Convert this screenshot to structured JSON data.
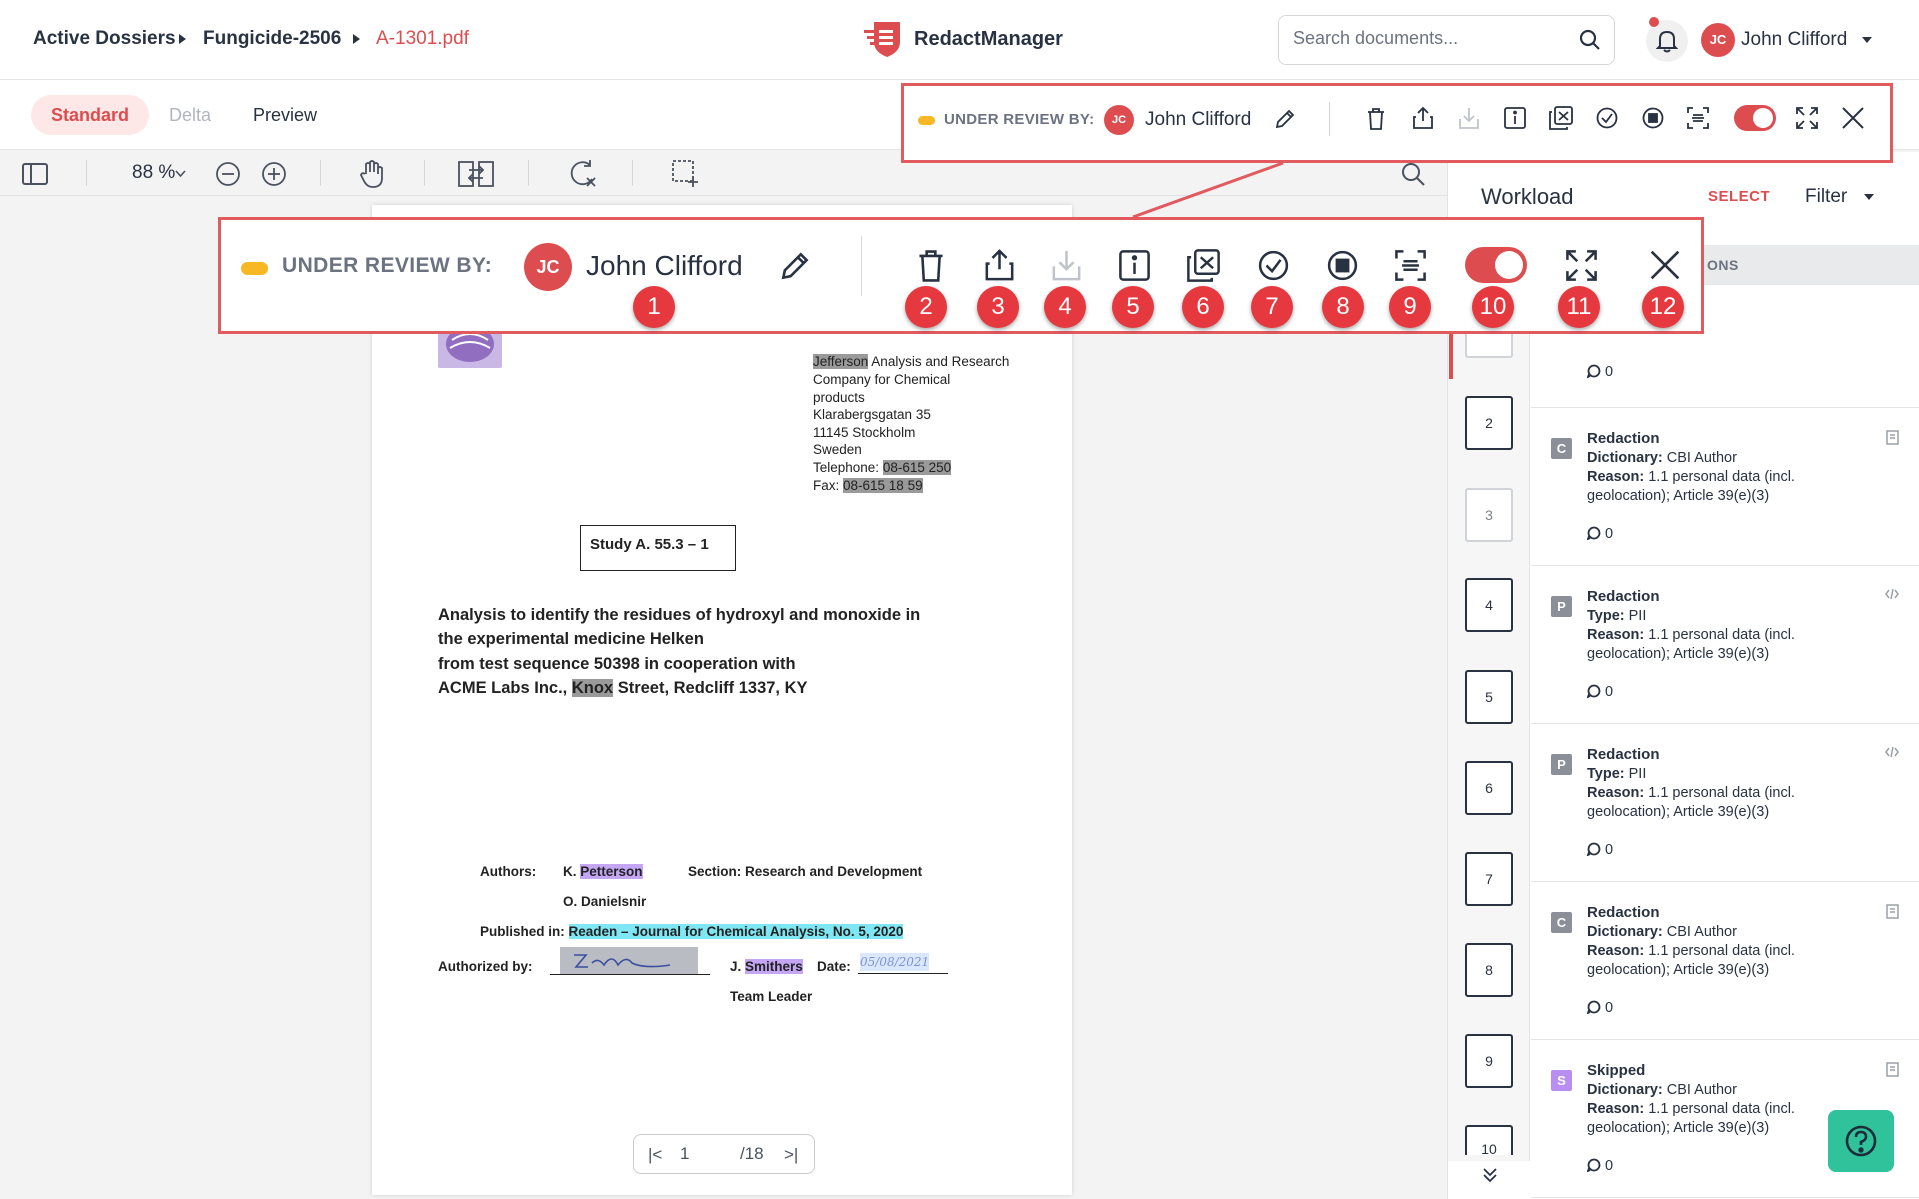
{
  "breadcrumb": {
    "items": [
      "Active Dossiers",
      "Fungicide-2506"
    ],
    "current": "A-1301.pdf"
  },
  "app": {
    "name": "RedactManager"
  },
  "search": {
    "placeholder": "Search documents..."
  },
  "user": {
    "initials": "JC",
    "name": "John Clifford"
  },
  "modes": {
    "standard": "Standard",
    "delta": "Delta",
    "preview": "Preview"
  },
  "viewer": {
    "zoom": "88 %"
  },
  "status": {
    "label": "UNDER REVIEW BY:",
    "reviewer_initials": "JC",
    "reviewer_name": "John Clifford",
    "status_color": "#f7b824",
    "toggle_color": "#dd4d50"
  },
  "callout_numbers": [
    "1",
    "2",
    "3",
    "4",
    "5",
    "6",
    "7",
    "8",
    "9",
    "10",
    "11",
    "12"
  ],
  "document": {
    "company": [
      "Jefferson",
      " Analysis and Research"
    ],
    "address_lines": [
      "Company for Chemical",
      "products",
      "Klarabergsgatan 35",
      "11145 Stockholm",
      "Sweden"
    ],
    "telephone_label": "Telephone: ",
    "telephone": "08-615 250",
    "fax_label": "Fax: ",
    "fax": "08-615 18 59",
    "study": "Study A. 55.3 – 1",
    "title_lines": [
      "Analysis to identify the residues of hydroxyl and monoxide in",
      "the experimental medicine Helken",
      "from test sequence 50398 in cooperation with"
    ],
    "title_last_prefix": "ACME Labs Inc., ",
    "title_last_hl": "Knox",
    "title_last_suffix": " Street, Redcliff 1337, KY",
    "authors_label": "Authors:",
    "author1_prefix": "K. ",
    "author1_hl": "Petterson",
    "section": "Section: Research and Development",
    "author2": "O. Danielsnir",
    "published_label": "Published in: ",
    "published": "Readen – Journal for Chemical Analysis, No. 5, 2020",
    "authorized_label": "Authorized by:",
    "signer_prefix": "J. ",
    "signer_hl": "Smithers",
    "date_label": "Date:",
    "date_value": "05/08/2021",
    "team_leader": "Team Leader"
  },
  "pager": {
    "current": "1",
    "total": "/18"
  },
  "workload": {
    "title": "Workload",
    "select": "SELECT",
    "filter": "Filter",
    "header_suffix": "ONS",
    "pages": [
      "2",
      "3",
      "4",
      "5",
      "6",
      "7",
      "8",
      "9",
      "10"
    ],
    "first_count": "0",
    "annotations": [
      {
        "badge": "C",
        "badge_color": "#8a8f98",
        "title": "Redaction",
        "key": "Dictionary:",
        "value": " CBI Author",
        "reason_key": "Reason:",
        "reason1": " 1.1 personal data (incl.",
        "reason2": "geolocation); Article 39(e)(3)",
        "count": "0",
        "icon": "document-icon"
      },
      {
        "badge": "P",
        "badge_color": "#8a8f98",
        "title": "Redaction",
        "key": "Type:",
        "value": " PII",
        "reason_key": "Reason:",
        "reason1": " 1.1 personal data (incl.",
        "reason2": "geolocation); Article 39(e)(3)",
        "count": "0",
        "icon": "code-icon"
      },
      {
        "badge": "P",
        "badge_color": "#8a8f98",
        "title": "Redaction",
        "key": "Type:",
        "value": " PII",
        "reason_key": "Reason:",
        "reason1": " 1.1 personal data (incl.",
        "reason2": "geolocation); Article 39(e)(3)",
        "count": "0",
        "icon": "code-icon"
      },
      {
        "badge": "C",
        "badge_color": "#8a8f98",
        "title": "Redaction",
        "key": "Dictionary:",
        "value": " CBI Author",
        "reason_key": "Reason:",
        "reason1": " 1.1 personal data (incl.",
        "reason2": "geolocation); Article 39(e)(3)",
        "count": "0",
        "icon": "document-icon"
      },
      {
        "badge": "S",
        "badge_color": "#b98ef3",
        "title": "Skipped",
        "key": "Dictionary:",
        "value": " CBI Author",
        "reason_key": "Reason:",
        "reason1": " 1.1 personal data (incl.",
        "reason2": "geolocation); Article 39(e)(3)",
        "count": "0",
        "icon": "document-icon"
      }
    ]
  },
  "colors": {
    "accent": "#dd4d50",
    "callout_border": "#e05a5e",
    "marker": "#e5393f",
    "help": "#2fc29b"
  }
}
